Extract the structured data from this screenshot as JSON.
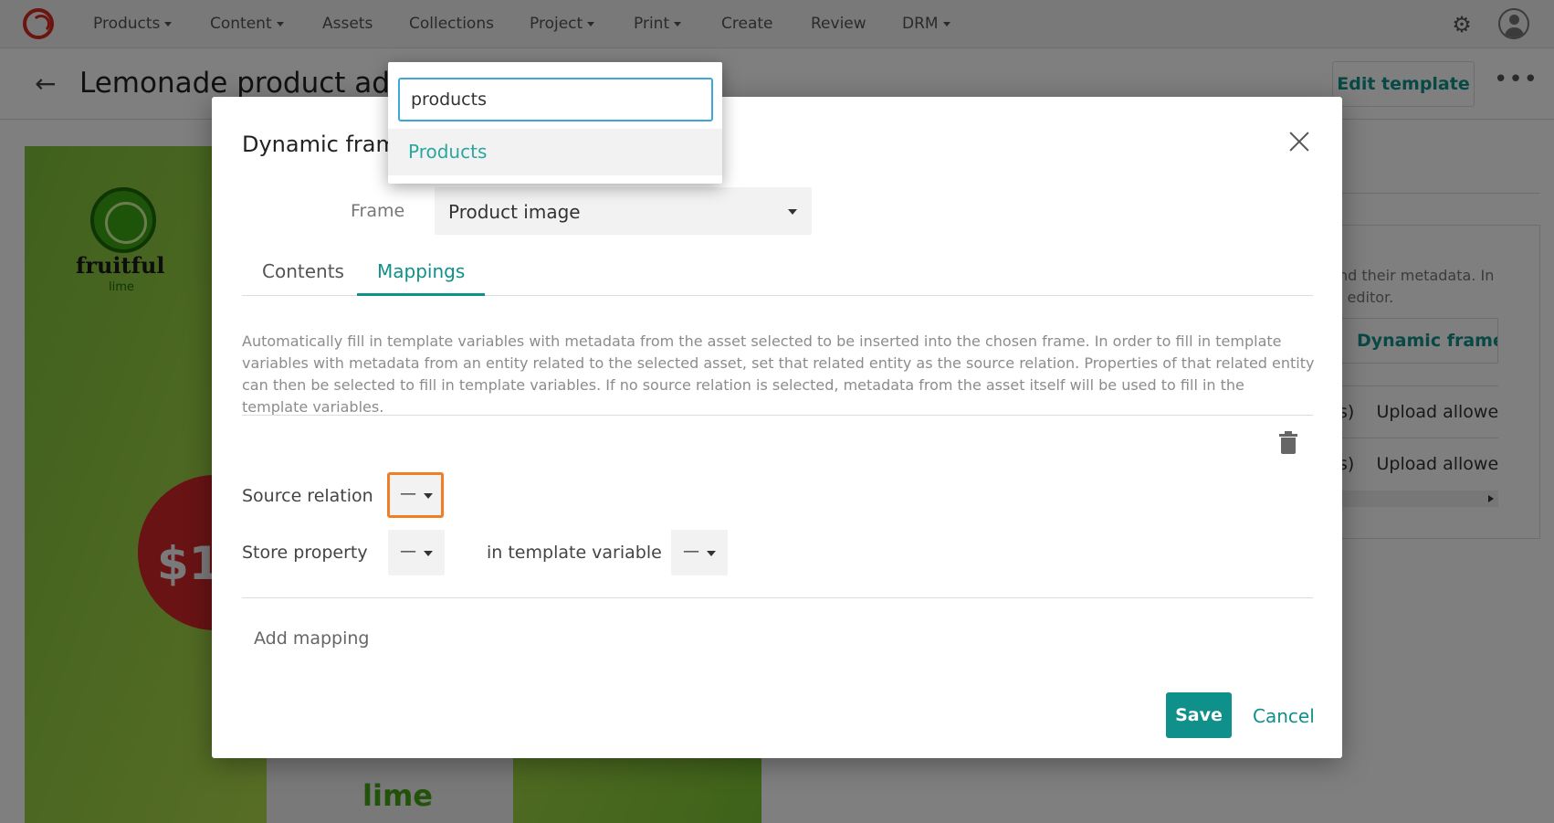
{
  "topnav": {
    "items": [
      {
        "label": "Products",
        "has_caret": true
      },
      {
        "label": "Content",
        "has_caret": true
      },
      {
        "label": "Assets",
        "has_caret": false
      },
      {
        "label": "Collections",
        "has_caret": false
      },
      {
        "label": "Project",
        "has_caret": true
      },
      {
        "label": "Print",
        "has_caret": true
      },
      {
        "label": "Create",
        "has_caret": false
      },
      {
        "label": "Review",
        "has_caret": false
      },
      {
        "label": "DRM",
        "has_caret": true
      }
    ],
    "settings_icon": "gear-icon",
    "user_icon": "user-avatar-icon"
  },
  "page": {
    "title": "Lemonade product ad",
    "edit_template_label": "Edit template",
    "more_icon": "more-horizontal-icon"
  },
  "preview": {
    "brand": "fruitful",
    "brand_sub": "lime",
    "price": "$1",
    "can_label": "lime"
  },
  "side_panel": {
    "text_line1": "nd their metadata. In",
    "text_line2": "l editor.",
    "dynamic_frame_button": "Dynamic frame",
    "rows": [
      {
        "prefix": "s)",
        "label": "Upload allowe"
      },
      {
        "prefix": "s)",
        "label": "Upload allowe"
      }
    ]
  },
  "modal": {
    "title": "Dynamic frame",
    "frame_label": "Frame",
    "frame_value": "Product image",
    "tabs": [
      {
        "label": "Contents",
        "active": false
      },
      {
        "label": "Mappings",
        "active": true
      }
    ],
    "help_text": "Automatically fill in template variables with metadata from the asset selected to be inserted into the chosen frame. In order to fill in template variables with metadata from an entity related to the selected asset, set that related entity as the source relation. Properties of that related entity can then be selected to fill in template variables. If no source relation is selected, metadata from the asset itself will be used to fill in the template variables.",
    "source_relation_label": "Source relation",
    "source_relation_value": "—",
    "store_property_label": "Store property",
    "store_property_value": "—",
    "template_variable_label": "in template variable",
    "template_variable_value": "—",
    "add_mapping_label": "Add mapping",
    "save_label": "Save",
    "cancel_label": "Cancel"
  },
  "dropdown": {
    "search_value": "products",
    "options": [
      "Products"
    ]
  },
  "colors": {
    "accent": "#10908a",
    "focus": "#f07e26",
    "search_border": "#3fa6d8"
  }
}
